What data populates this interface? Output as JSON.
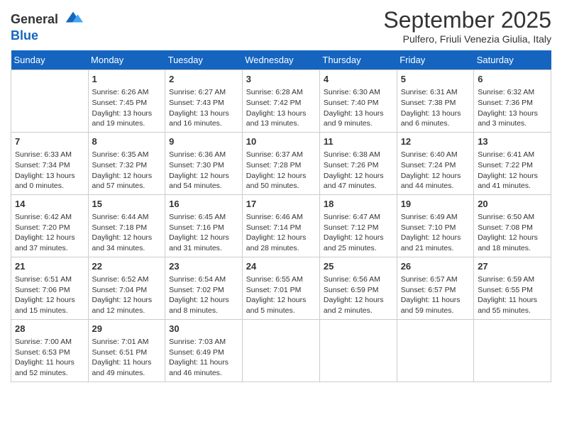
{
  "logo": {
    "line1": "General",
    "line2": "Blue"
  },
  "title": "September 2025",
  "subtitle": "Pulfero, Friuli Venezia Giulia, Italy",
  "days_of_week": [
    "Sunday",
    "Monday",
    "Tuesday",
    "Wednesday",
    "Thursday",
    "Friday",
    "Saturday"
  ],
  "weeks": [
    [
      {
        "day": "",
        "sunrise": "",
        "sunset": "",
        "daylight": ""
      },
      {
        "day": "1",
        "sunrise": "6:26 AM",
        "sunset": "7:45 PM",
        "daylight": "13 hours and 19 minutes."
      },
      {
        "day": "2",
        "sunrise": "6:27 AM",
        "sunset": "7:43 PM",
        "daylight": "13 hours and 16 minutes."
      },
      {
        "day": "3",
        "sunrise": "6:28 AM",
        "sunset": "7:42 PM",
        "daylight": "13 hours and 13 minutes."
      },
      {
        "day": "4",
        "sunrise": "6:30 AM",
        "sunset": "7:40 PM",
        "daylight": "13 hours and 9 minutes."
      },
      {
        "day": "5",
        "sunrise": "6:31 AM",
        "sunset": "7:38 PM",
        "daylight": "13 hours and 6 minutes."
      },
      {
        "day": "6",
        "sunrise": "6:32 AM",
        "sunset": "7:36 PM",
        "daylight": "13 hours and 3 minutes."
      }
    ],
    [
      {
        "day": "7",
        "sunrise": "6:33 AM",
        "sunset": "7:34 PM",
        "daylight": "13 hours and 0 minutes."
      },
      {
        "day": "8",
        "sunrise": "6:35 AM",
        "sunset": "7:32 PM",
        "daylight": "12 hours and 57 minutes."
      },
      {
        "day": "9",
        "sunrise": "6:36 AM",
        "sunset": "7:30 PM",
        "daylight": "12 hours and 54 minutes."
      },
      {
        "day": "10",
        "sunrise": "6:37 AM",
        "sunset": "7:28 PM",
        "daylight": "12 hours and 50 minutes."
      },
      {
        "day": "11",
        "sunrise": "6:38 AM",
        "sunset": "7:26 PM",
        "daylight": "12 hours and 47 minutes."
      },
      {
        "day": "12",
        "sunrise": "6:40 AM",
        "sunset": "7:24 PM",
        "daylight": "12 hours and 44 minutes."
      },
      {
        "day": "13",
        "sunrise": "6:41 AM",
        "sunset": "7:22 PM",
        "daylight": "12 hours and 41 minutes."
      }
    ],
    [
      {
        "day": "14",
        "sunrise": "6:42 AM",
        "sunset": "7:20 PM",
        "daylight": "12 hours and 37 minutes."
      },
      {
        "day": "15",
        "sunrise": "6:44 AM",
        "sunset": "7:18 PM",
        "daylight": "12 hours and 34 minutes."
      },
      {
        "day": "16",
        "sunrise": "6:45 AM",
        "sunset": "7:16 PM",
        "daylight": "12 hours and 31 minutes."
      },
      {
        "day": "17",
        "sunrise": "6:46 AM",
        "sunset": "7:14 PM",
        "daylight": "12 hours and 28 minutes."
      },
      {
        "day": "18",
        "sunrise": "6:47 AM",
        "sunset": "7:12 PM",
        "daylight": "12 hours and 25 minutes."
      },
      {
        "day": "19",
        "sunrise": "6:49 AM",
        "sunset": "7:10 PM",
        "daylight": "12 hours and 21 minutes."
      },
      {
        "day": "20",
        "sunrise": "6:50 AM",
        "sunset": "7:08 PM",
        "daylight": "12 hours and 18 minutes."
      }
    ],
    [
      {
        "day": "21",
        "sunrise": "6:51 AM",
        "sunset": "7:06 PM",
        "daylight": "12 hours and 15 minutes."
      },
      {
        "day": "22",
        "sunrise": "6:52 AM",
        "sunset": "7:04 PM",
        "daylight": "12 hours and 12 minutes."
      },
      {
        "day": "23",
        "sunrise": "6:54 AM",
        "sunset": "7:02 PM",
        "daylight": "12 hours and 8 minutes."
      },
      {
        "day": "24",
        "sunrise": "6:55 AM",
        "sunset": "7:01 PM",
        "daylight": "12 hours and 5 minutes."
      },
      {
        "day": "25",
        "sunrise": "6:56 AM",
        "sunset": "6:59 PM",
        "daylight": "12 hours and 2 minutes."
      },
      {
        "day": "26",
        "sunrise": "6:57 AM",
        "sunset": "6:57 PM",
        "daylight": "11 hours and 59 minutes."
      },
      {
        "day": "27",
        "sunrise": "6:59 AM",
        "sunset": "6:55 PM",
        "daylight": "11 hours and 55 minutes."
      }
    ],
    [
      {
        "day": "28",
        "sunrise": "7:00 AM",
        "sunset": "6:53 PM",
        "daylight": "11 hours and 52 minutes."
      },
      {
        "day": "29",
        "sunrise": "7:01 AM",
        "sunset": "6:51 PM",
        "daylight": "11 hours and 49 minutes."
      },
      {
        "day": "30",
        "sunrise": "7:03 AM",
        "sunset": "6:49 PM",
        "daylight": "11 hours and 46 minutes."
      },
      {
        "day": "",
        "sunrise": "",
        "sunset": "",
        "daylight": ""
      },
      {
        "day": "",
        "sunrise": "",
        "sunset": "",
        "daylight": ""
      },
      {
        "day": "",
        "sunrise": "",
        "sunset": "",
        "daylight": ""
      },
      {
        "day": "",
        "sunrise": "",
        "sunset": "",
        "daylight": ""
      }
    ]
  ]
}
